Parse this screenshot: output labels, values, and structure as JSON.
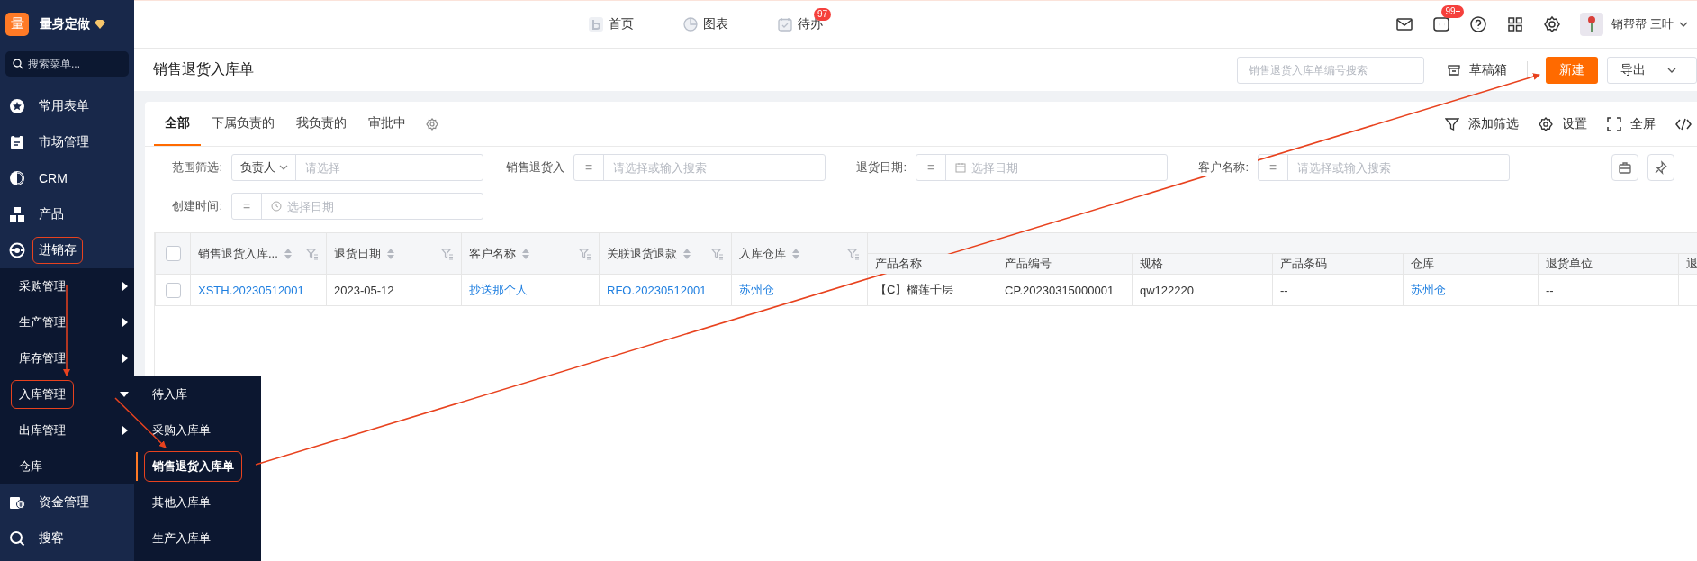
{
  "sidebar": {
    "logo": "量",
    "brand": "量身定做",
    "search": {
      "placeholder": "搜索菜单..."
    },
    "items": [
      {
        "label": "常用表单",
        "annotated": false
      },
      {
        "label": "市场管理",
        "annotated": false
      },
      {
        "label": "CRM",
        "annotated": false
      },
      {
        "label": "产品",
        "annotated": false
      },
      {
        "label": "进销存",
        "annotated": true,
        "expanded": true,
        "children": [
          {
            "label": "采购管理",
            "kind": "group",
            "expanded": false,
            "annotated": false
          },
          {
            "label": "生产管理",
            "kind": "group",
            "expanded": false,
            "annotated": false
          },
          {
            "label": "库存管理",
            "kind": "group",
            "expanded": false,
            "annotated": false
          },
          {
            "label": "入库管理",
            "kind": "group",
            "expanded": true,
            "annotated": true,
            "children": [
              {
                "label": "待入库",
                "selected": false,
                "annotated": false
              },
              {
                "label": "采购入库单",
                "selected": false,
                "annotated": false
              },
              {
                "label": "销售退货入库单",
                "selected": true,
                "annotated": true
              },
              {
                "label": "其他入库单",
                "selected": false,
                "annotated": false
              },
              {
                "label": "生产入库单",
                "selected": false,
                "annotated": false
              }
            ]
          },
          {
            "label": "出库管理",
            "kind": "group",
            "expanded": false,
            "annotated": false
          },
          {
            "label": "仓库",
            "kind": "leaf",
            "annotated": false
          }
        ]
      },
      {
        "label": "资金管理",
        "annotated": false
      },
      {
        "label": "搜客",
        "annotated": false
      }
    ]
  },
  "top_nav": [
    {
      "label": "首页"
    },
    {
      "label": "图表"
    },
    {
      "label": "待办",
      "badge": "97"
    }
  ],
  "top_right": {
    "message_badge": "99+",
    "user": "销帮帮 三叶"
  },
  "page_header": {
    "title": "销售退货入库单",
    "search": {
      "placeholder": "销售退货入库单编号搜索"
    },
    "drafts": "草稿箱",
    "new_button": "新建",
    "export": "导出"
  },
  "tabs": [
    {
      "label": "全部",
      "selected": true
    },
    {
      "label": "下属负责的",
      "selected": false
    },
    {
      "label": "我负责的",
      "selected": false
    },
    {
      "label": "审批中",
      "selected": false
    }
  ],
  "tools": [
    {
      "label": "添加筛选"
    },
    {
      "label": "设置"
    },
    {
      "label": "全屏"
    }
  ],
  "filters": [
    {
      "label": "范围筛选:",
      "kind": "owner",
      "prefix": "负责人",
      "placeholder": "请选择"
    },
    {
      "label": "销售退货入",
      "kind": "text",
      "operator": "=",
      "placeholder": "请选择或输入搜索"
    },
    {
      "label": "退货日期:",
      "kind": "date",
      "operator": "=",
      "placeholder": "选择日期"
    },
    {
      "label": "客户名称:",
      "kind": "text",
      "operator": "=",
      "placeholder": "请选择或输入搜索"
    },
    {
      "label": "创建时间:",
      "kind": "time",
      "operator": "=",
      "placeholder": "选择日期"
    }
  ],
  "table": {
    "header_checked": false,
    "columns": [
      {
        "label": "销售退货入库...",
        "sortable": true,
        "filterable": true
      },
      {
        "label": "退货日期",
        "sortable": true,
        "filterable": true
      },
      {
        "label": "客户名称",
        "sortable": true,
        "filterable": true
      },
      {
        "label": "关联退货退款",
        "sortable": true,
        "filterable": true
      },
      {
        "label": "入库仓库",
        "sortable": true,
        "filterable": true
      }
    ],
    "group_columns": [
      "产品名称",
      "产品编号",
      "规格",
      "产品条码",
      "仓库",
      "退货单位",
      "退"
    ],
    "rows": [
      {
        "checked": false,
        "cells": [
          {
            "text": "XSTH.20230512001",
            "link": true
          },
          {
            "text": "2023-05-12",
            "link": false
          },
          {
            "text": "抄送那个人",
            "link": true
          },
          {
            "text": "RFO.20230512001",
            "link": true
          },
          {
            "text": "苏州仓",
            "link": true
          },
          {
            "text": "【C】榴莲千层",
            "link": false
          },
          {
            "text": "CP.20230315000001",
            "link": false
          },
          {
            "text": "qw122220",
            "link": false
          },
          {
            "text": "--",
            "link": false
          },
          {
            "text": "苏州仓",
            "link": true
          },
          {
            "text": "--",
            "link": false
          }
        ]
      }
    ]
  }
}
